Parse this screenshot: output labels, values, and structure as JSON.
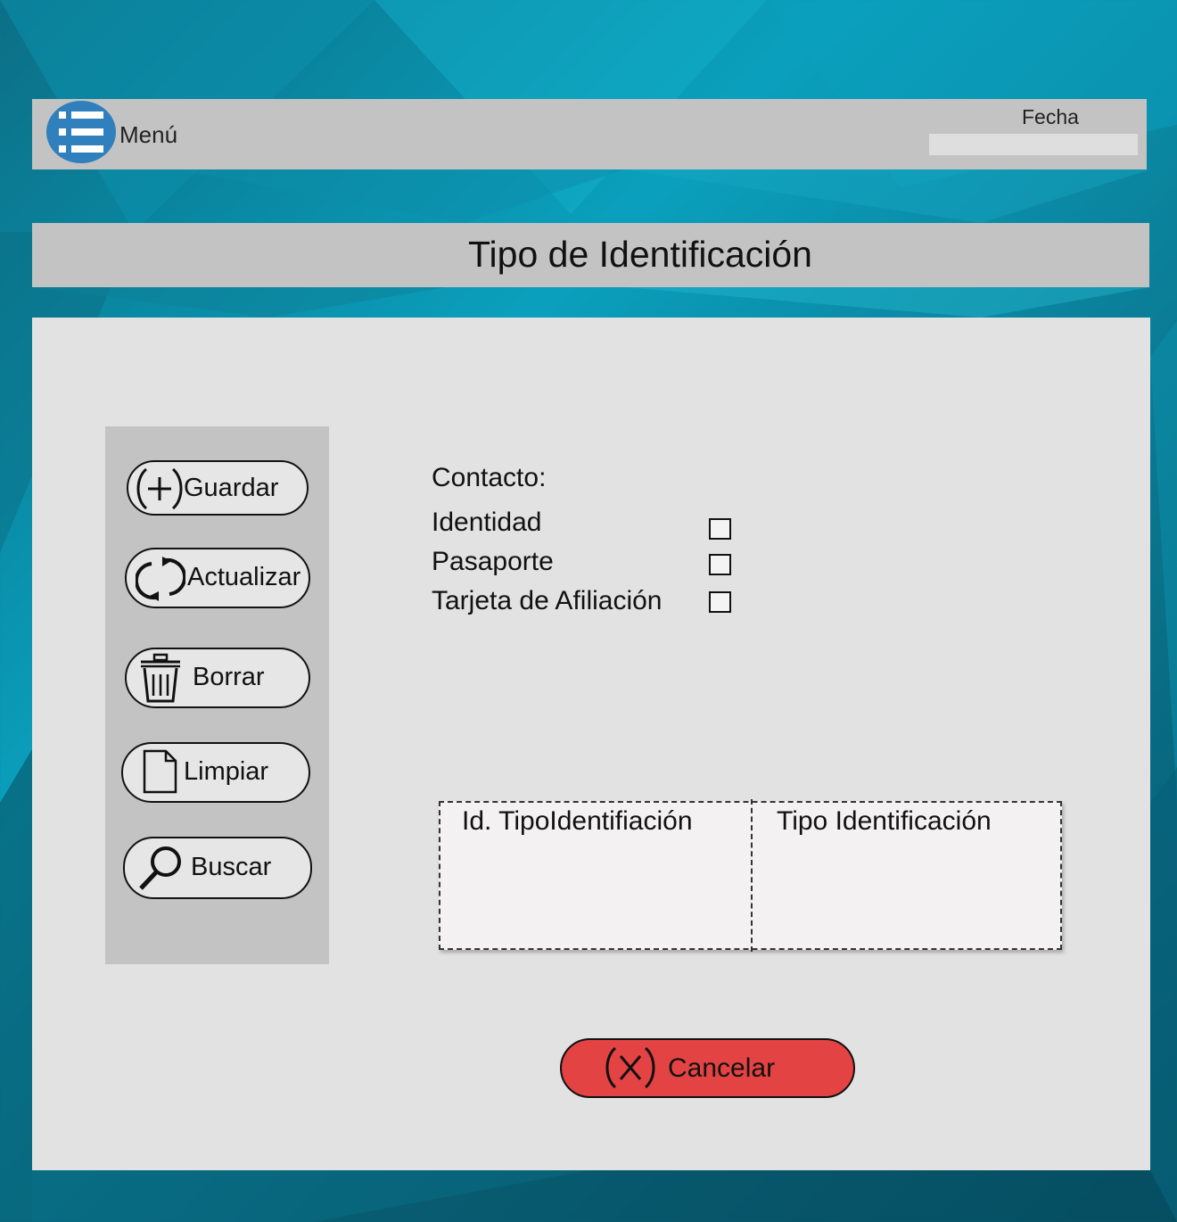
{
  "header": {
    "menu_label": "Menú",
    "menu_icon": "list-icon",
    "fecha_label": "Fecha",
    "fecha_value": ""
  },
  "page": {
    "title": "Tipo de Identificación"
  },
  "sidebar": {
    "buttons": [
      {
        "label": "Guardar",
        "icon": "plus-circle-icon"
      },
      {
        "label": "Actualizar",
        "icon": "refresh-icon"
      },
      {
        "label": "Borrar",
        "icon": "trash-icon"
      },
      {
        "label": "Limpiar",
        "icon": "document-icon"
      },
      {
        "label": "Buscar",
        "icon": "search-icon"
      }
    ]
  },
  "form": {
    "section_label": "Contacto:",
    "options": [
      {
        "label": "Identidad",
        "checked": false
      },
      {
        "label": "Pasaporte",
        "checked": false
      },
      {
        "label": "Tarjeta de Afiliación",
        "checked": false
      }
    ]
  },
  "table": {
    "columns": [
      "Id. TipoIdentifiación",
      "Tipo Identificación"
    ],
    "rows": []
  },
  "cancel": {
    "label": "Cancelar",
    "icon": "x-circle-icon",
    "color": "#e44343"
  },
  "colors": {
    "menu_button": "#2f80bd",
    "bar_gray": "#c3c3c3",
    "panel_gray": "#e2e2e2"
  }
}
